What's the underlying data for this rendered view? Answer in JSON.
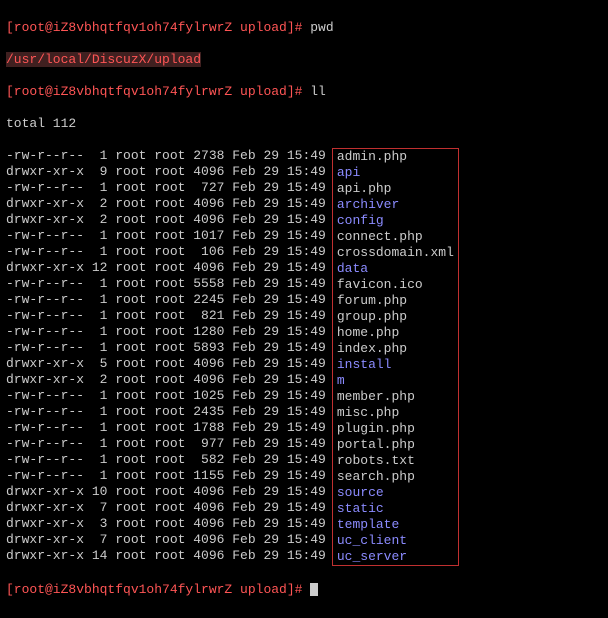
{
  "prompt": {
    "ps1": "[root@iZ8vbhqtfqv1oh74fylrwrZ upload]# ",
    "cmd_pwd": "pwd",
    "cmd_ll": "ll"
  },
  "pwd_output": "/usr/local/DiscuzX/upload",
  "total_line": "total 112",
  "files": [
    {
      "perm": "-rw-r--r--",
      "ln": " 1",
      "o": "root",
      "g": "root",
      "sz": "2738",
      "m": "Feb",
      "d": "29",
      "t": "15:49",
      "name": "admin.php",
      "dir": false
    },
    {
      "perm": "drwxr-xr-x",
      "ln": " 9",
      "o": "root",
      "g": "root",
      "sz": "4096",
      "m": "Feb",
      "d": "29",
      "t": "15:49",
      "name": "api",
      "dir": true
    },
    {
      "perm": "-rw-r--r--",
      "ln": " 1",
      "o": "root",
      "g": "root",
      "sz": " 727",
      "m": "Feb",
      "d": "29",
      "t": "15:49",
      "name": "api.php",
      "dir": false
    },
    {
      "perm": "drwxr-xr-x",
      "ln": " 2",
      "o": "root",
      "g": "root",
      "sz": "4096",
      "m": "Feb",
      "d": "29",
      "t": "15:49",
      "name": "archiver",
      "dir": true
    },
    {
      "perm": "drwxr-xr-x",
      "ln": " 2",
      "o": "root",
      "g": "root",
      "sz": "4096",
      "m": "Feb",
      "d": "29",
      "t": "15:49",
      "name": "config",
      "dir": true
    },
    {
      "perm": "-rw-r--r--",
      "ln": " 1",
      "o": "root",
      "g": "root",
      "sz": "1017",
      "m": "Feb",
      "d": "29",
      "t": "15:49",
      "name": "connect.php",
      "dir": false
    },
    {
      "perm": "-rw-r--r--",
      "ln": " 1",
      "o": "root",
      "g": "root",
      "sz": " 106",
      "m": "Feb",
      "d": "29",
      "t": "15:49",
      "name": "crossdomain.xml",
      "dir": false
    },
    {
      "perm": "drwxr-xr-x",
      "ln": "12",
      "o": "root",
      "g": "root",
      "sz": "4096",
      "m": "Feb",
      "d": "29",
      "t": "15:49",
      "name": "data",
      "dir": true
    },
    {
      "perm": "-rw-r--r--",
      "ln": " 1",
      "o": "root",
      "g": "root",
      "sz": "5558",
      "m": "Feb",
      "d": "29",
      "t": "15:49",
      "name": "favicon.ico",
      "dir": false
    },
    {
      "perm": "-rw-r--r--",
      "ln": " 1",
      "o": "root",
      "g": "root",
      "sz": "2245",
      "m": "Feb",
      "d": "29",
      "t": "15:49",
      "name": "forum.php",
      "dir": false
    },
    {
      "perm": "-rw-r--r--",
      "ln": " 1",
      "o": "root",
      "g": "root",
      "sz": " 821",
      "m": "Feb",
      "d": "29",
      "t": "15:49",
      "name": "group.php",
      "dir": false
    },
    {
      "perm": "-rw-r--r--",
      "ln": " 1",
      "o": "root",
      "g": "root",
      "sz": "1280",
      "m": "Feb",
      "d": "29",
      "t": "15:49",
      "name": "home.php",
      "dir": false
    },
    {
      "perm": "-rw-r--r--",
      "ln": " 1",
      "o": "root",
      "g": "root",
      "sz": "5893",
      "m": "Feb",
      "d": "29",
      "t": "15:49",
      "name": "index.php",
      "dir": false
    },
    {
      "perm": "drwxr-xr-x",
      "ln": " 5",
      "o": "root",
      "g": "root",
      "sz": "4096",
      "m": "Feb",
      "d": "29",
      "t": "15:49",
      "name": "install",
      "dir": true
    },
    {
      "perm": "drwxr-xr-x",
      "ln": " 2",
      "o": "root",
      "g": "root",
      "sz": "4096",
      "m": "Feb",
      "d": "29",
      "t": "15:49",
      "name": "m",
      "dir": true
    },
    {
      "perm": "-rw-r--r--",
      "ln": " 1",
      "o": "root",
      "g": "root",
      "sz": "1025",
      "m": "Feb",
      "d": "29",
      "t": "15:49",
      "name": "member.php",
      "dir": false
    },
    {
      "perm": "-rw-r--r--",
      "ln": " 1",
      "o": "root",
      "g": "root",
      "sz": "2435",
      "m": "Feb",
      "d": "29",
      "t": "15:49",
      "name": "misc.php",
      "dir": false
    },
    {
      "perm": "-rw-r--r--",
      "ln": " 1",
      "o": "root",
      "g": "root",
      "sz": "1788",
      "m": "Feb",
      "d": "29",
      "t": "15:49",
      "name": "plugin.php",
      "dir": false
    },
    {
      "perm": "-rw-r--r--",
      "ln": " 1",
      "o": "root",
      "g": "root",
      "sz": " 977",
      "m": "Feb",
      "d": "29",
      "t": "15:49",
      "name": "portal.php",
      "dir": false
    },
    {
      "perm": "-rw-r--r--",
      "ln": " 1",
      "o": "root",
      "g": "root",
      "sz": " 582",
      "m": "Feb",
      "d": "29",
      "t": "15:49",
      "name": "robots.txt",
      "dir": false
    },
    {
      "perm": "-rw-r--r--",
      "ln": " 1",
      "o": "root",
      "g": "root",
      "sz": "1155",
      "m": "Feb",
      "d": "29",
      "t": "15:49",
      "name": "search.php",
      "dir": false
    },
    {
      "perm": "drwxr-xr-x",
      "ln": "10",
      "o": "root",
      "g": "root",
      "sz": "4096",
      "m": "Feb",
      "d": "29",
      "t": "15:49",
      "name": "source",
      "dir": true
    },
    {
      "perm": "drwxr-xr-x",
      "ln": " 7",
      "o": "root",
      "g": "root",
      "sz": "4096",
      "m": "Feb",
      "d": "29",
      "t": "15:49",
      "name": "static",
      "dir": true
    },
    {
      "perm": "drwxr-xr-x",
      "ln": " 3",
      "o": "root",
      "g": "root",
      "sz": "4096",
      "m": "Feb",
      "d": "29",
      "t": "15:49",
      "name": "template",
      "dir": true
    },
    {
      "perm": "drwxr-xr-x",
      "ln": " 7",
      "o": "root",
      "g": "root",
      "sz": "4096",
      "m": "Feb",
      "d": "29",
      "t": "15:49",
      "name": "uc_client",
      "dir": true
    },
    {
      "perm": "drwxr-xr-x",
      "ln": "14",
      "o": "root",
      "g": "root",
      "sz": "4096",
      "m": "Feb",
      "d": "29",
      "t": "15:49",
      "name": "uc_server",
      "dir": true
    }
  ]
}
